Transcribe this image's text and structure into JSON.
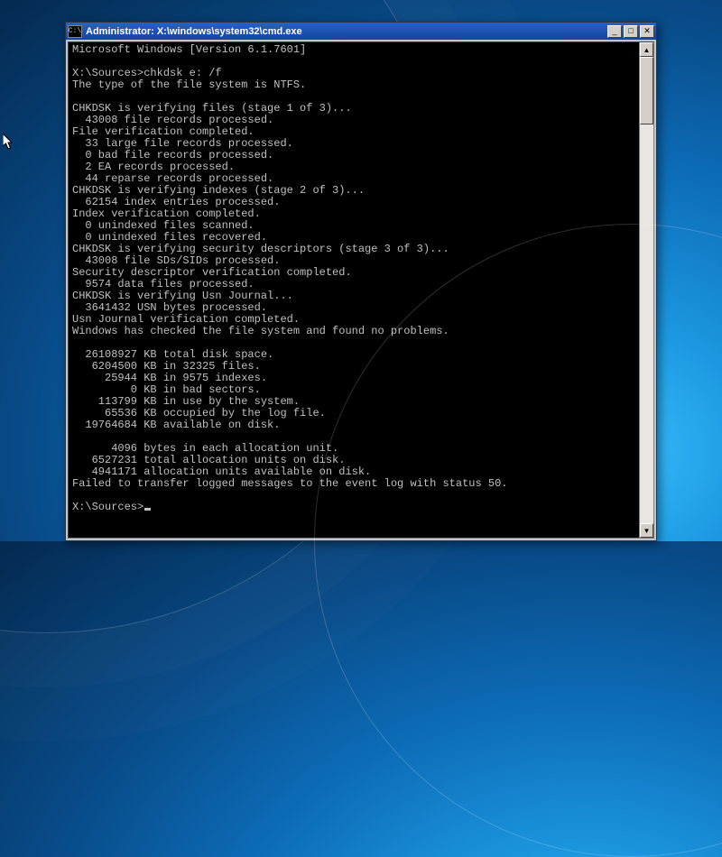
{
  "window": {
    "title_prefix": "Administrator: ",
    "title_path": "X:\\windows\\system32\\cmd.exe",
    "icon_glyph": "C:\\"
  },
  "controls": {
    "min_glyph": "_",
    "max_glyph": "□",
    "close_glyph": "✕",
    "scroll_up_glyph": "▲",
    "scroll_down_glyph": "▼"
  },
  "console": {
    "l00": "Microsoft Windows [Version 6.1.7601]",
    "l01": "",
    "l02": "X:\\Sources>chkdsk e: /f",
    "l03": "The type of the file system is NTFS.",
    "l04": "",
    "l05": "CHKDSK is verifying files (stage 1 of 3)...",
    "l06": "  43008 file records processed.",
    "l07": "File verification completed.",
    "l08": "  33 large file records processed.",
    "l09": "  0 bad file records processed.",
    "l10": "  2 EA records processed.",
    "l11": "  44 reparse records processed.",
    "l12": "CHKDSK is verifying indexes (stage 2 of 3)...",
    "l13": "  62154 index entries processed.",
    "l14": "Index verification completed.",
    "l15": "  0 unindexed files scanned.",
    "l16": "  0 unindexed files recovered.",
    "l17": "CHKDSK is verifying security descriptors (stage 3 of 3)...",
    "l18": "  43008 file SDs/SIDs processed.",
    "l19": "Security descriptor verification completed.",
    "l20": "  9574 data files processed.",
    "l21": "CHKDSK is verifying Usn Journal...",
    "l22": "  3641432 USN bytes processed.",
    "l23": "Usn Journal verification completed.",
    "l24": "Windows has checked the file system and found no problems.",
    "l25": "",
    "l26": "  26108927 KB total disk space.",
    "l27": "   6204500 KB in 32325 files.",
    "l28": "     25944 KB in 9575 indexes.",
    "l29": "         0 KB in bad sectors.",
    "l30": "    113799 KB in use by the system.",
    "l31": "     65536 KB occupied by the log file.",
    "l32": "  19764684 KB available on disk.",
    "l33": "",
    "l34": "      4096 bytes in each allocation unit.",
    "l35": "   6527231 total allocation units on disk.",
    "l36": "   4941171 allocation units available on disk.",
    "l37": "Failed to transfer logged messages to the event log with status 50.",
    "l38": "",
    "l39_prompt": "X:\\Sources>"
  }
}
